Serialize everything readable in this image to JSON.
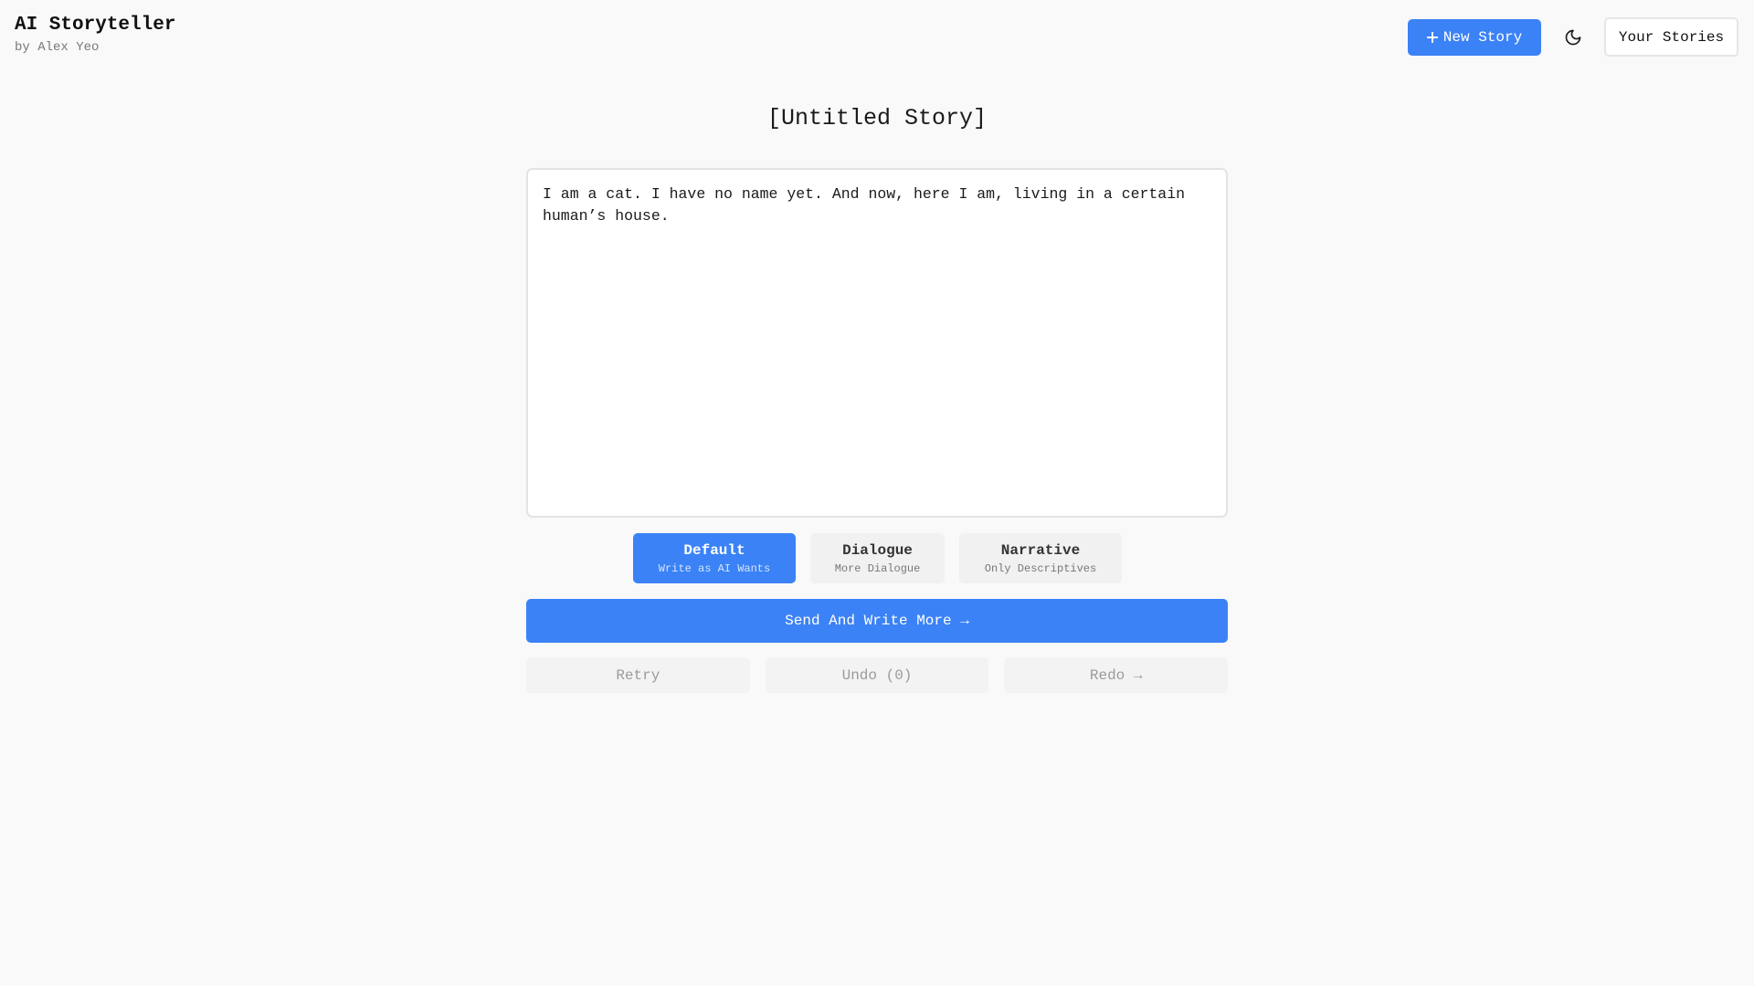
{
  "header": {
    "app_title": "AI Storyteller",
    "app_subtitle": "by Alex Yeo",
    "new_story_label": "New Story",
    "new_story_icon": "plus-icon",
    "theme_toggle_icon": "moon-icon",
    "your_stories_label": "Your Stories"
  },
  "story": {
    "title": "[Untitled Story]",
    "content": "I am a cat. I have no name yet. And now, here I am, living in a certain human’s house."
  },
  "modes": [
    {
      "label": "Default",
      "subtitle": "Write as AI Wants",
      "selected": true
    },
    {
      "label": "Dialogue",
      "subtitle": "More Dialogue",
      "selected": false
    },
    {
      "label": "Narrative",
      "subtitle": "Only Descriptives",
      "selected": false
    }
  ],
  "actions": {
    "send_label": "Send And Write More →",
    "retry_label": "Retry",
    "undo_label": "Undo (0)",
    "redo_label": "Redo →"
  },
  "colors": {
    "accent": "#3b82f6",
    "background": "#f9f9f9"
  }
}
